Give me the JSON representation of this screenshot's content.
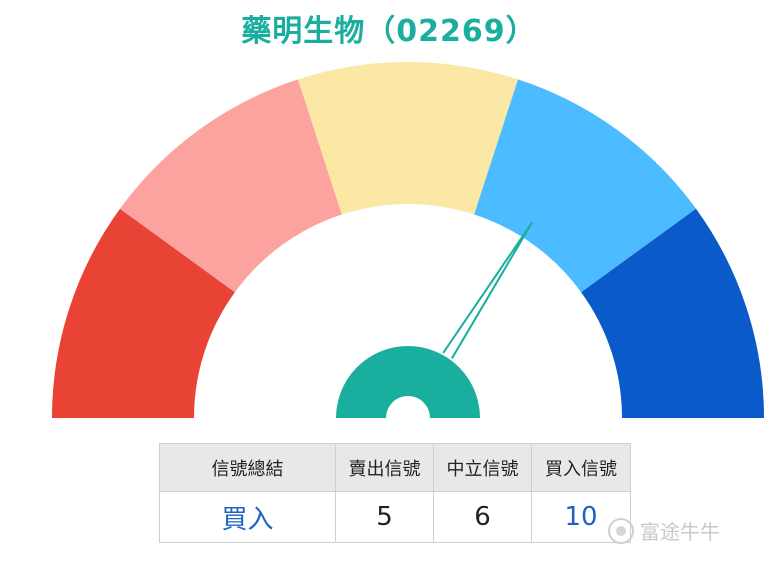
{
  "chart_data": {
    "type": "gauge",
    "title": "藥明生物（02269）",
    "segments": [
      {
        "color": "#e94336"
      },
      {
        "color": "#fca29f"
      },
      {
        "color": "#fae8a4"
      },
      {
        "color": "#4dbbff"
      },
      {
        "color": "#0a5ac9"
      }
    ],
    "needle_value": 0.68,
    "needle_color": "#1aae9f"
  },
  "summary_table": {
    "headers": [
      "信號總結",
      "賣出信號",
      "中立信號",
      "買入信號"
    ],
    "values": [
      "買入",
      "5",
      "6",
      "10"
    ]
  },
  "watermark": {
    "text": "富途牛牛"
  }
}
